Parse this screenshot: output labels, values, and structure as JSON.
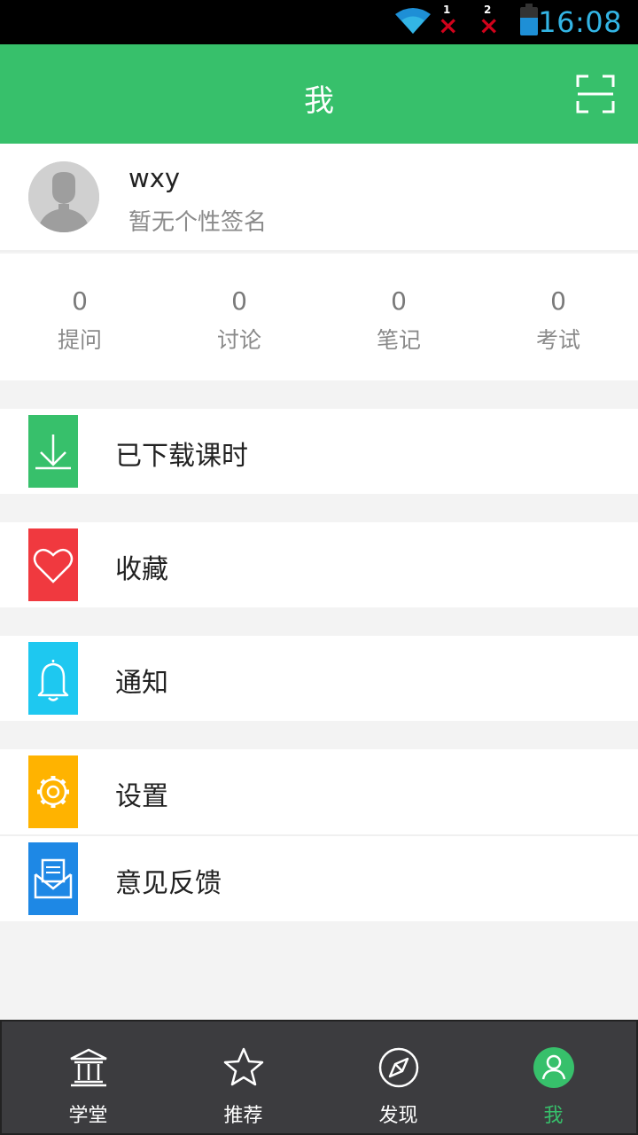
{
  "status_bar": {
    "time": "16:08",
    "sim1": "1",
    "sim2": "2"
  },
  "header": {
    "title": "我"
  },
  "profile": {
    "username": "wxy",
    "signature": "暂无个性签名"
  },
  "stats": [
    {
      "value": "0",
      "label": "提问"
    },
    {
      "value": "0",
      "label": "讨论"
    },
    {
      "value": "0",
      "label": "笔记"
    },
    {
      "value": "0",
      "label": "考试"
    }
  ],
  "menu": [
    {
      "label": "已下载课时",
      "icon": "download-icon",
      "color": "#37c06b"
    },
    {
      "label": "收藏",
      "icon": "heart-icon",
      "color": "#f0393f"
    },
    {
      "label": "通知",
      "icon": "bell-icon",
      "color": "#1ec8f0"
    },
    {
      "label": "设置",
      "icon": "gear-icon",
      "color": "#ffb300"
    },
    {
      "label": "意见反馈",
      "icon": "mail-icon",
      "color": "#1e88e5"
    }
  ],
  "tabs": [
    {
      "label": "学堂",
      "icon": "building-icon"
    },
    {
      "label": "推荐",
      "icon": "star-icon"
    },
    {
      "label": "发现",
      "icon": "compass-icon"
    },
    {
      "label": "我",
      "icon": "person-icon",
      "active": true
    }
  ],
  "colors": {
    "accent": "#37c06b",
    "tabbar": "#3c3c3f"
  }
}
